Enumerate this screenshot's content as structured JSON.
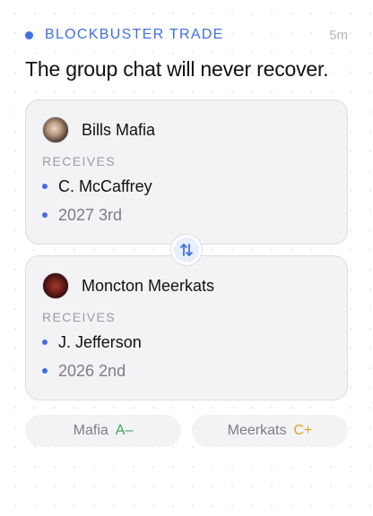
{
  "header": {
    "tag": "BLOCKBUSTER TRADE",
    "time": "5m"
  },
  "headline": "The group chat will never recover.",
  "sides": [
    {
      "team": "Bills Mafia",
      "receives_label": "RECEIVES",
      "assets": [
        "C. McCaffrey",
        "2027 3rd"
      ]
    },
    {
      "team": "Moncton Meerkats",
      "receives_label": "RECEIVES",
      "assets": [
        "J. Jefferson",
        "2026 2nd"
      ]
    }
  ],
  "grades": [
    {
      "team": "Mafia",
      "grade": "A–",
      "color": "#3da35d"
    },
    {
      "team": "Meerkats",
      "grade": "C+",
      "color": "#e6a12a"
    }
  ],
  "colors": {
    "accent": "#3f6fe0",
    "grade_good": "#3da35d",
    "grade_ok": "#e6a12a"
  },
  "icons": {
    "swap": "swap-vertical-arrows-icon",
    "tag_dot": "dot-icon"
  }
}
